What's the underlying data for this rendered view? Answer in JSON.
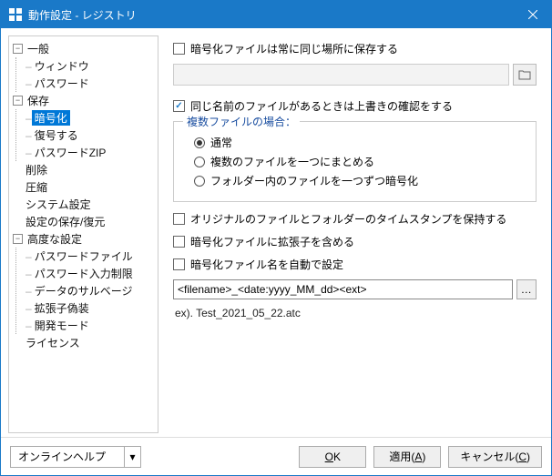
{
  "title": "動作設定 - レジストリ",
  "tree": {
    "general": "一般",
    "window": "ウィンドウ",
    "password": "パスワード",
    "save": "保存",
    "encrypt": "暗号化",
    "decrypt": "復号する",
    "passwordzip": "パスワードZIP",
    "delete": "削除",
    "compress": "圧縮",
    "system": "システム設定",
    "saverestore": "設定の保存/復元",
    "advanced": "高度な設定",
    "pwfile": "パスワードファイル",
    "pwlimit": "パスワード入力制限",
    "salvage": "データのサルベージ",
    "ext": "拡張子偽装",
    "dev": "開発モード",
    "license": "ライセンス"
  },
  "content": {
    "chk_same_location": "暗号化ファイルは常に同じ場所に保存する",
    "chk_overwrite": "同じ名前のファイルがあるときは上書きの確認をする",
    "group_title": "複数ファイルの場合：",
    "radio_normal": "通常",
    "radio_combine": "複数のファイルを一つにまとめる",
    "radio_eachfolder": "フォルダー内のファイルを一つずつ暗号化",
    "chk_timestamp": "オリジナルのファイルとフォルダーのタイムスタンプを保持する",
    "chk_addext": "暗号化ファイルに拡張子を含める",
    "chk_autoname": "暗号化ファイル名を自動で設定",
    "filename_pattern": "<filename>_<date:yyyy_MM_dd><ext>",
    "example": "ex). Test_2021_05_22.atc"
  },
  "footer": {
    "help": "オンラインヘルプ",
    "ok": "OK",
    "apply": "適用(A)",
    "cancel": "キャンセル(C)"
  }
}
